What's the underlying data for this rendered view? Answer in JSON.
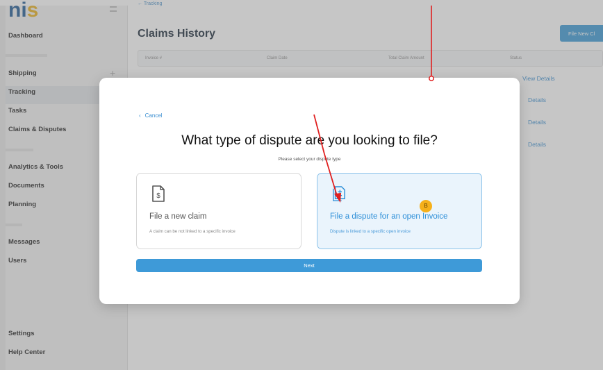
{
  "app": {
    "logo_text": "ni",
    "logo_accent": "s",
    "brand_color": "#1f5a94"
  },
  "sidebar": {
    "items": [
      {
        "label": "Dashboard"
      },
      {
        "label": "Shipping"
      },
      {
        "label": "Tracking"
      },
      {
        "label": "Tasks"
      },
      {
        "label": "Claims & Disputes"
      },
      {
        "label": "Analytics & Tools"
      },
      {
        "label": "Documents"
      },
      {
        "label": "Planning"
      },
      {
        "label": "Messages"
      },
      {
        "label": "Users"
      },
      {
        "label": "Settings"
      },
      {
        "label": "Help Center"
      }
    ]
  },
  "main": {
    "page_title": "Claims History",
    "file_new_button": "File New Cl",
    "table": {
      "columns": [
        "Invoice #",
        "Claim Date",
        "Total Claim Amount",
        "Status"
      ]
    },
    "row_link": "Details",
    "first_row_link": "View Details"
  },
  "modal": {
    "cancel_label": "Cancel",
    "title": "What type of dispute are you looking to file?",
    "subtitle": "Please select your dispute type",
    "options": [
      {
        "icon": "document-dollar-icon",
        "title": "File a new claim",
        "description": "A claim can be not linked to a specific invoice",
        "selected": false
      },
      {
        "icon": "document-plus-icon",
        "title": "File a dispute for an open Invoice",
        "description": "Dispute is linked to a specific open invoice",
        "selected": true
      }
    ],
    "next_label": "Next"
  },
  "annotations": {
    "step_badge": "B",
    "arrow_color": "#e02020"
  }
}
